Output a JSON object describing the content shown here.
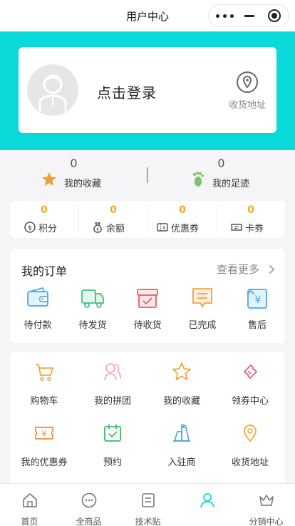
{
  "navbar": {
    "title": "用户中心"
  },
  "profile": {
    "login_text": "点击登录",
    "address_label": "收货地址"
  },
  "stats": [
    {
      "value": "0",
      "label": "我的收藏",
      "icon": "star-icon"
    },
    {
      "value": "0",
      "label": "我的足迹",
      "icon": "footprint-icon"
    }
  ],
  "wallet": [
    {
      "value": "0",
      "label": "积分",
      "icon": "coin-icon"
    },
    {
      "value": "0",
      "label": "余额",
      "icon": "money-bag-icon"
    },
    {
      "value": "0",
      "label": "优惠券",
      "icon": "coupon-icon"
    },
    {
      "value": "0",
      "label": "卡券",
      "icon": "ticket-icon"
    }
  ],
  "orders": {
    "title": "我的订单",
    "more": "查看更多",
    "items": [
      {
        "label": "待付款",
        "icon": "wallet-icon"
      },
      {
        "label": "待发货",
        "icon": "truck-icon"
      },
      {
        "label": "待收货",
        "icon": "receive-box-icon"
      },
      {
        "label": "已完成",
        "icon": "completed-doc-icon"
      },
      {
        "label": "售后",
        "icon": "after-sales-icon"
      }
    ]
  },
  "services": [
    {
      "label": "购物车",
      "icon": "cart-icon"
    },
    {
      "label": "我的拼团",
      "icon": "group-icon"
    },
    {
      "label": "我的收藏",
      "icon": "star-outline-icon"
    },
    {
      "label": "领券中心",
      "icon": "coupon-center-icon"
    },
    {
      "label": "我的优惠券",
      "icon": "my-coupon-icon"
    },
    {
      "label": "预约",
      "icon": "reserve-icon"
    },
    {
      "label": "入驻商",
      "icon": "merchant-icon"
    },
    {
      "label": "收货地址",
      "icon": "location-icon"
    }
  ],
  "tabbar": [
    {
      "label": "首页",
      "icon": "home-icon"
    },
    {
      "label": "全商品",
      "icon": "all-goods-icon"
    },
    {
      "label": "技术贴",
      "icon": "article-icon"
    },
    {
      "label": "",
      "icon": "user-icon"
    },
    {
      "label": "分销中心",
      "icon": "crown-icon"
    }
  ],
  "colors": {
    "header": "#0ad9da",
    "accent": "#f5a623",
    "active_tab": "#0ad9da"
  }
}
